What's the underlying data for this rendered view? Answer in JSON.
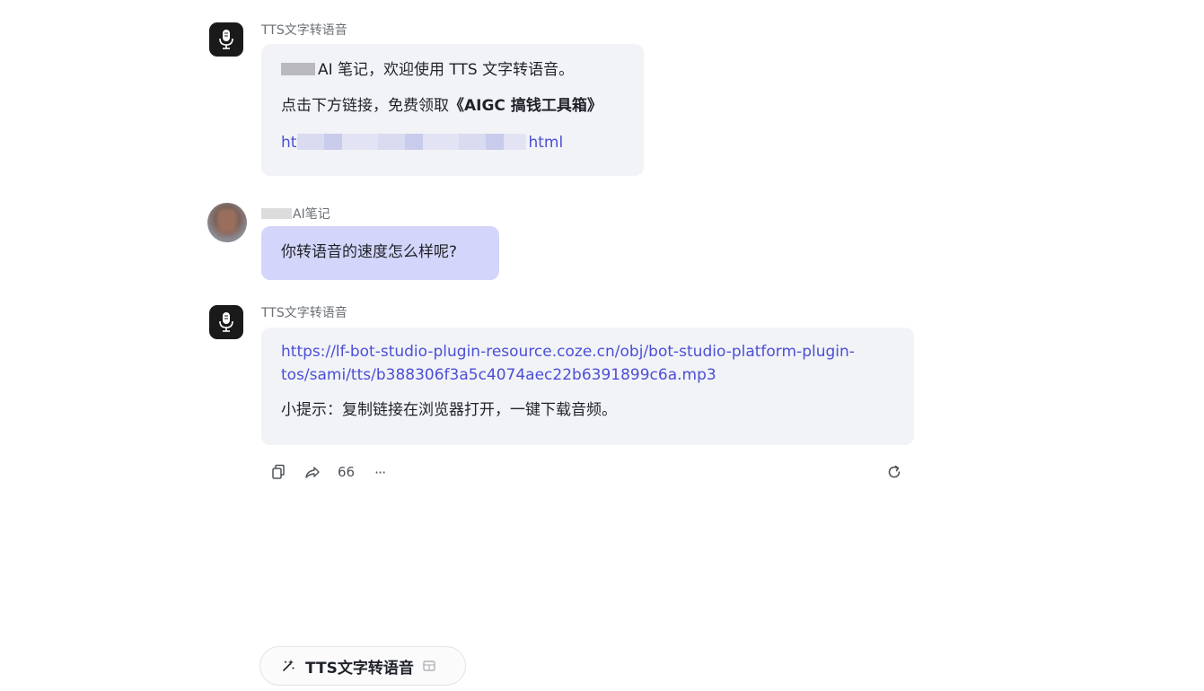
{
  "conversation": {
    "messages": [
      {
        "role": "bot",
        "sender": "TTS文字转语音",
        "lines": [
          "AI 笔记，欢迎使用 TTS 文字转语音。",
          "点击下方链接，免费领取",
          "《AIGC 搞钱工具箱》",
          "ht",
          "html"
        ]
      },
      {
        "role": "user",
        "sender": "AI笔记",
        "text": "你转语音的速度怎么样呢?"
      },
      {
        "role": "bot",
        "sender": "TTS文字转语音",
        "link_line1": "https://lf-bot-studio-plugin-resource.coze.cn/obj/bot-studio-platform-plugin-",
        "link_line2": "tos/sami/tts/b388306f3a5c4074aec22b6391899c6a.mp3",
        "tip": "小提示：复制链接在浏览器打开，一键下载音频。"
      }
    ]
  },
  "actions": {
    "count": "66",
    "more": "···"
  },
  "skill_chip": {
    "label": "TTS文字转语音"
  },
  "icons": {
    "bot_avatar": "microphone-icon",
    "copy": "copy-icon",
    "share": "share-icon",
    "more": "more-icon",
    "refresh": "refresh-icon",
    "skill": "sparkle-icon",
    "chip_badge": "grid-icon"
  },
  "colors": {
    "bot_bubble": "#f2f3f7",
    "user_bubble": "#d4d5fa",
    "link": "#4b4fd6"
  }
}
